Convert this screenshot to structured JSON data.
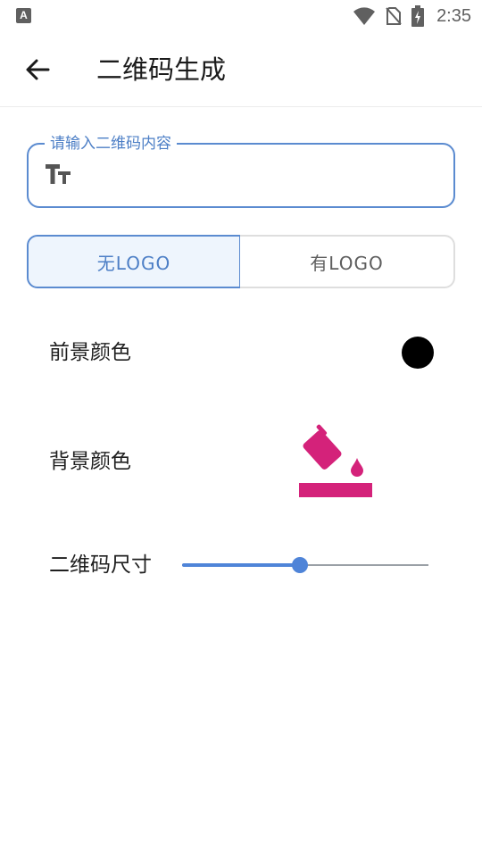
{
  "status_bar": {
    "app_icon_letter": "A",
    "icons": [
      "wifi-icon",
      "no-sim-icon",
      "battery-charging-icon"
    ],
    "time": "2:35"
  },
  "app_bar": {
    "back_icon": "arrow-left-icon",
    "title": "二维码生成"
  },
  "content_input": {
    "label": "请输入二维码内容",
    "value": "",
    "icon": "text-size-icon",
    "accent_color": "#5b8bd0"
  },
  "logo_toggle": {
    "options": [
      "无LOGO",
      "有LOGO"
    ],
    "selected_index": 0
  },
  "foreground_color": {
    "label": "前景颜色",
    "value": "#000000"
  },
  "background_color": {
    "label": "背景颜色",
    "icon": "paint-bucket-icon",
    "icon_color": "#d4227a"
  },
  "qr_size": {
    "label": "二维码尺寸",
    "fraction": 0.48,
    "accent_color": "#4f84d8"
  }
}
